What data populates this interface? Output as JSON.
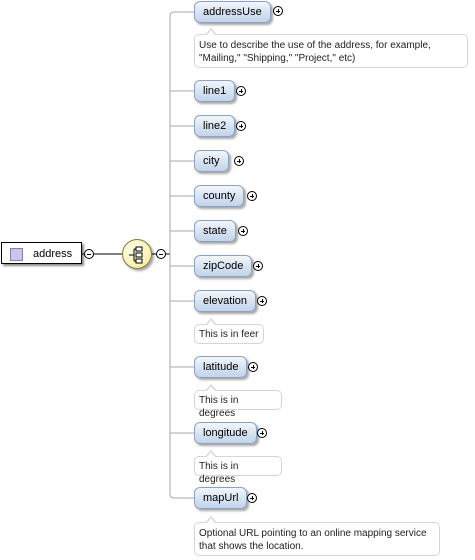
{
  "root": {
    "name": "address",
    "icon": "attribute-group-icon"
  },
  "compositor": {
    "icon": "sequence-compositor-icon"
  },
  "elements": [
    {
      "id": "addressUse",
      "label": "addressUse",
      "note": "Use to describe the use of the address, for example, \"Mailing,\" \"Shipping,\" \"Project,\" etc)"
    },
    {
      "id": "line1",
      "label": "line1"
    },
    {
      "id": "line2",
      "label": "line2"
    },
    {
      "id": "city",
      "label": "city"
    },
    {
      "id": "county",
      "label": "county"
    },
    {
      "id": "state",
      "label": "state"
    },
    {
      "id": "zipcode",
      "label": "zipCode"
    },
    {
      "id": "elevation",
      "label": "elevation",
      "note": "This is in feer"
    },
    {
      "id": "latitude",
      "label": "latitude",
      "note": "This is in degrees"
    },
    {
      "id": "longitude",
      "label": "longitude",
      "note": "This is in degrees"
    },
    {
      "id": "mapurl",
      "label": "mapUrl",
      "note": "Optional URL pointing to an online mapping service that shows the location."
    }
  ]
}
